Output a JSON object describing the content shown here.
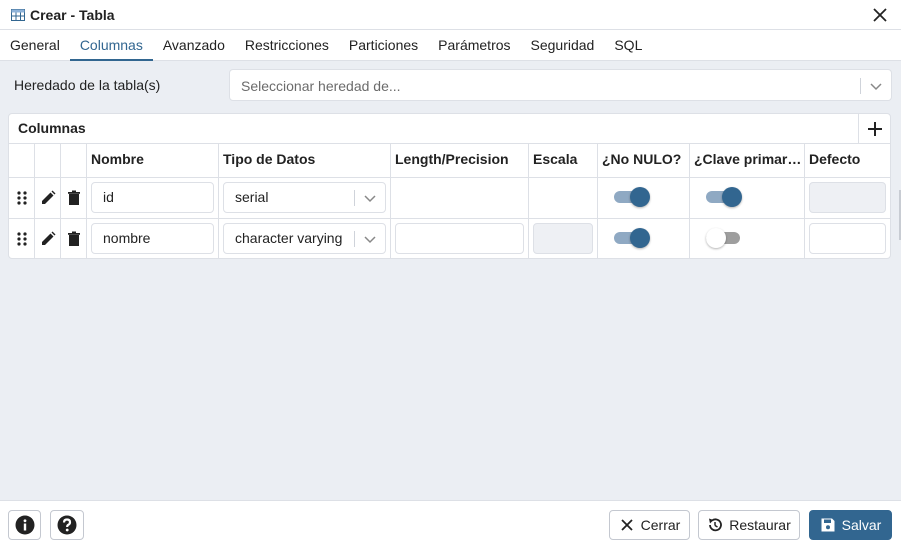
{
  "window": {
    "title": "Crear - Tabla"
  },
  "tabs": [
    {
      "label": "General"
    },
    {
      "label": "Columnas"
    },
    {
      "label": "Avanzado"
    },
    {
      "label": "Restricciones"
    },
    {
      "label": "Particiones"
    },
    {
      "label": "Parámetros"
    },
    {
      "label": "Seguridad"
    },
    {
      "label": "SQL"
    }
  ],
  "active_tab": "Columnas",
  "inherit": {
    "label": "Heredado de la tabla(s)",
    "placeholder": "Seleccionar heredad de..."
  },
  "columns_panel": {
    "title": "Columnas",
    "headers": [
      "Nombre",
      "Tipo de Datos",
      "Length/Precision",
      "Escala",
      "¿No NULO?",
      "¿Clave primar…",
      "Defecto"
    ],
    "rows": [
      {
        "name": "id",
        "type": "serial",
        "length": "",
        "scale": "",
        "not_null": true,
        "primary_key": true,
        "default": ""
      },
      {
        "name": "nombre",
        "type": "character varying",
        "length": "",
        "scale": "",
        "not_null": true,
        "primary_key": false,
        "default": ""
      }
    ]
  },
  "footer": {
    "close_label": "Cerrar",
    "reset_label": "Restaurar",
    "save_label": "Salvar"
  },
  "colors": {
    "accent": "#326690",
    "toggle_on_track": "#8fa9c3",
    "toggle_off_track": "#9e9e9e",
    "background": "#ebeef3"
  }
}
